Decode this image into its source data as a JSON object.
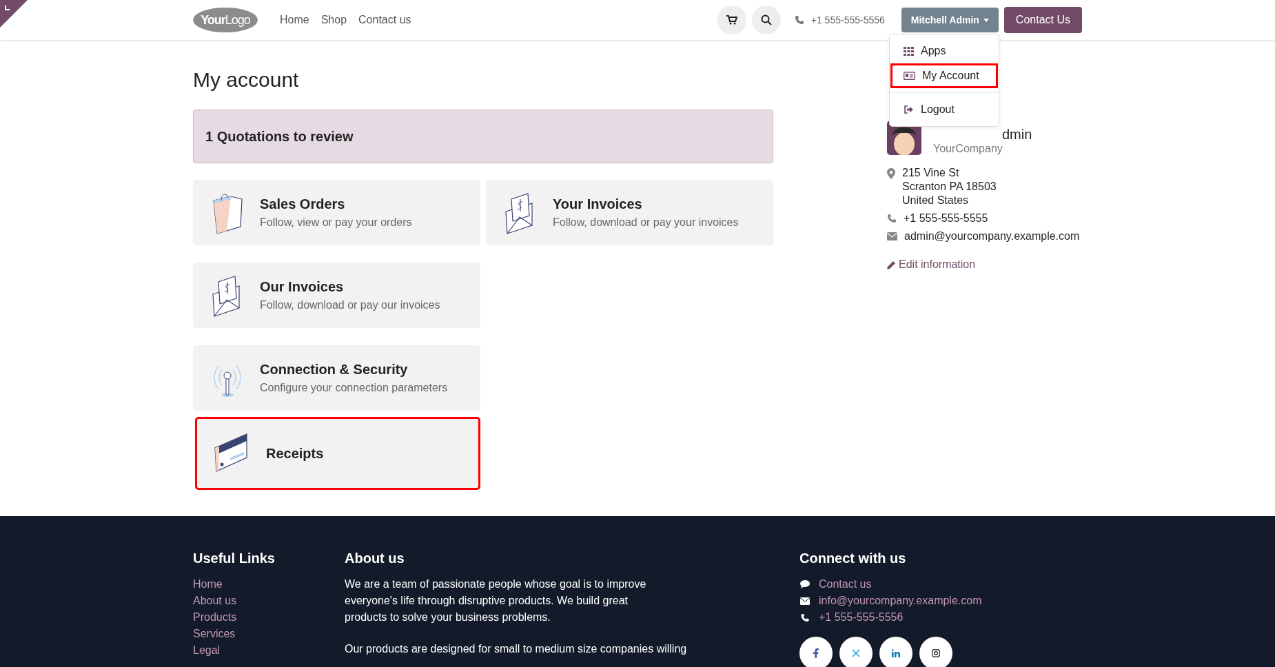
{
  "header": {
    "logo": {
      "word_bold": "Your",
      "word_light": "Logo"
    },
    "nav": [
      {
        "label": "Home",
        "selected": false
      },
      {
        "label": "Shop",
        "selected": false
      },
      {
        "label": "Contact us",
        "selected": false
      }
    ],
    "phone": "+1 555-555-5556",
    "user_button": "Mitchell Admin",
    "cta": "Contact Us"
  },
  "user_menu": {
    "expanded": true,
    "items": [
      {
        "kind": "apps",
        "label": "Apps",
        "highlighted": false
      },
      {
        "kind": "account",
        "label": "My Account",
        "highlighted": true
      },
      {
        "kind": "logout",
        "label": "Logout",
        "highlighted": false
      }
    ]
  },
  "page_title": "My account",
  "alert": {
    "count": "1",
    "label": "Quotations to review"
  },
  "cards": [
    {
      "kind": "bag",
      "title": "Sales Orders",
      "subtitle": "Follow, view or pay your orders",
      "highlighted": false
    },
    {
      "kind": "envelope",
      "title": "Your Invoices",
      "subtitle": "Follow, download or pay your invoices",
      "highlighted": false
    },
    {
      "kind": "envelope",
      "title": "Our Invoices",
      "subtitle": "Follow, download or pay our invoices",
      "highlighted": false
    },
    {
      "kind": "antenna",
      "title": "Connection & Security",
      "subtitle": "Configure your connection parameters",
      "highlighted": false
    },
    {
      "kind": "card",
      "title": "Receipts",
      "highlighted": true
    }
  ],
  "profile": {
    "name": "dmin",
    "company": "YourCompany",
    "address": [
      "215 Vine St",
      "Scranton PA 18503",
      "United States"
    ],
    "phone": "+1 555-555-5555",
    "email": "admin@yourcompany.example.com",
    "edit_link": "Edit information"
  },
  "footer": {
    "useful_links": {
      "title": "Useful Links",
      "links": [
        "Home",
        "About us",
        "Products",
        "Services",
        "Legal"
      ]
    },
    "about": {
      "title": "About us",
      "paragraphs": [
        "We are a team of passionate people whose goal is to improve everyone's life through disruptive products. We build great products to solve your business problems.",
        "Our products are designed for small to medium size companies willing"
      ]
    },
    "connect": {
      "title": "Connect with us",
      "items": [
        {
          "kind": "chat",
          "label": "Contact us"
        },
        {
          "kind": "mail",
          "label": "info@yourcompany.example.com"
        },
        {
          "kind": "phone",
          "label": "+1 555-555-5556"
        }
      ],
      "socials": [
        {
          "kind": "facebook"
        },
        {
          "kind": "x"
        },
        {
          "kind": "linkedin"
        },
        {
          "kind": "instagram"
        }
      ]
    }
  }
}
